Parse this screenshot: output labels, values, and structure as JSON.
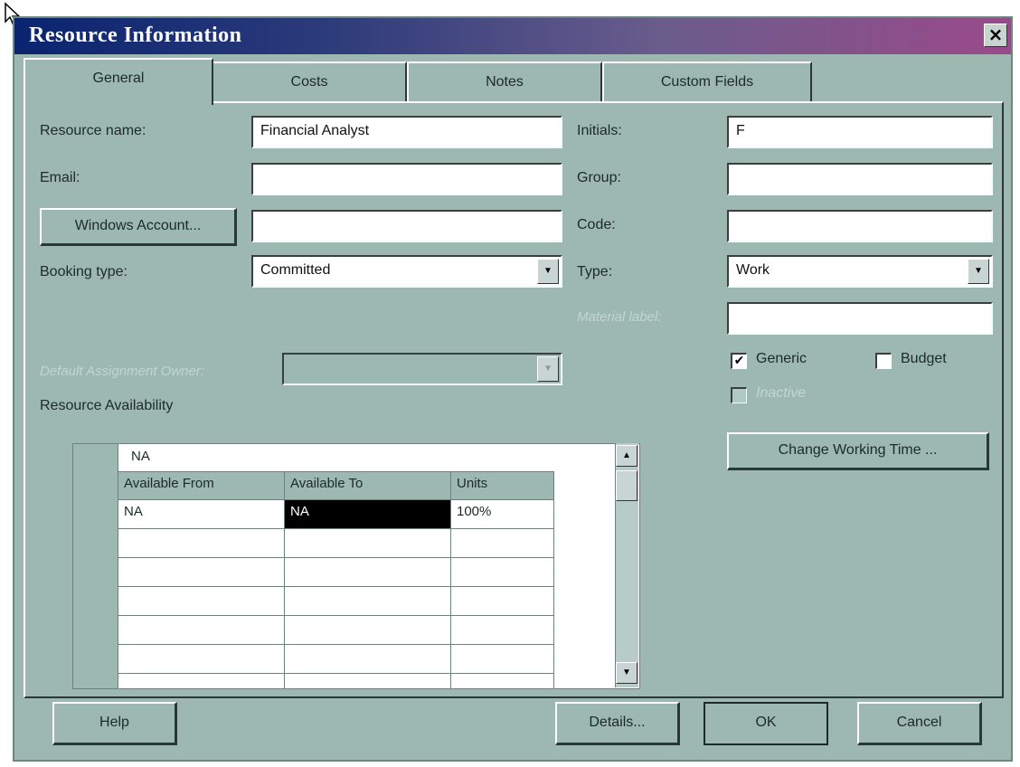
{
  "window": {
    "title": "Resource Information",
    "close_glyph": "×"
  },
  "tabs": [
    {
      "label": "General",
      "active": true
    },
    {
      "label": "Costs"
    },
    {
      "label": "Notes"
    },
    {
      "label": "Custom Fields"
    }
  ],
  "form": {
    "resource_name_label": "Resource name:",
    "resource_name_value": "Financial Analyst",
    "email_label": "Email:",
    "email_value": "",
    "windows_account_button": "Windows Account...",
    "windows_account_value": "",
    "booking_type_label": "Booking type:",
    "booking_type_value": "Committed",
    "initials_label": "Initials:",
    "initials_value": "F",
    "group_label": "Group:",
    "group_value": "",
    "code_label": "Code:",
    "code_value": "",
    "type_label": "Type:",
    "type_value": "Work",
    "material_label": "Material label:",
    "material_value": "",
    "default_assignment_owner_label": "Default Assignment Owner:",
    "default_assignment_owner_value": "",
    "generic_label": "Generic",
    "generic_checked": true,
    "budget_label": "Budget",
    "budget_checked": false,
    "inactive_label": "Inactive",
    "inactive_checked": false,
    "change_working_time_button": "Change Working Time ..."
  },
  "availability": {
    "label": "Resource Availability",
    "edit_value": "NA",
    "columns": [
      "Available From",
      "Available To",
      "Units"
    ],
    "rows": [
      [
        "NA",
        "NA",
        "100%"
      ]
    ]
  },
  "footer": {
    "help": "Help",
    "details": "Details...",
    "ok": "OK",
    "cancel": "Cancel"
  },
  "colors": {
    "dialog_bg": "#9cb8b0",
    "title_left": "#0a2470",
    "title_right": "#9a4a8a",
    "selected_cell": "#000000"
  }
}
